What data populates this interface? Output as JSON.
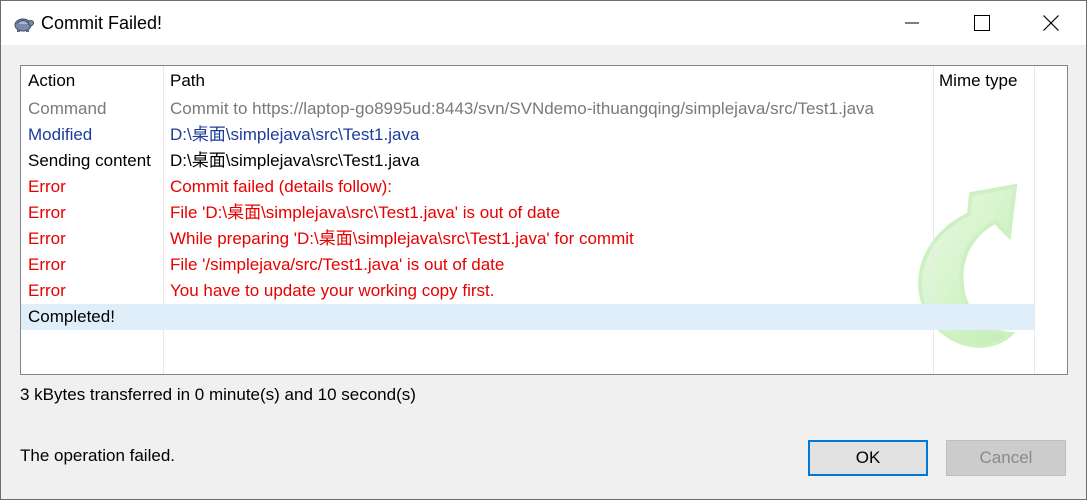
{
  "window": {
    "title": "Commit Failed!",
    "icon": "tortoisesvn-turtle-icon"
  },
  "columns": {
    "action": "Action",
    "path": "Path",
    "mime": "Mime type"
  },
  "rows": [
    {
      "action": "Command",
      "path": "Commit to https://laptop-go8995ud:8443/svn/SVNdemo-ithuangqing/simplejava/src/Test1.java",
      "color": "#7a7a7a"
    },
    {
      "action": "Modified",
      "path": "D:\\桌面\\simplejava\\src\\Test1.java",
      "color": "#1c3c9c"
    },
    {
      "action": "Sending content",
      "path": "D:\\桌面\\simplejava\\src\\Test1.java",
      "color": "#000000"
    },
    {
      "action": "Error",
      "path": "Commit failed (details follow):",
      "color": "#e60000"
    },
    {
      "action": "Error",
      "path": "File 'D:\\桌面\\simplejava\\src\\Test1.java' is out of date",
      "color": "#e60000"
    },
    {
      "action": "Error",
      "path": "While preparing 'D:\\桌面\\simplejava\\src\\Test1.java' for commit",
      "color": "#e60000"
    },
    {
      "action": "Error",
      "path": "File '/simplejava/src/Test1.java' is out of date",
      "color": "#e60000"
    },
    {
      "action": "Error",
      "path": "You have to update your working copy first.",
      "color": "#e60000"
    },
    {
      "action": "Completed!",
      "path": "",
      "color": "#000000"
    }
  ],
  "transfer_text": "3 kBytes transferred in 0 minute(s) and 10 second(s)",
  "status_text": "The operation failed.",
  "buttons": {
    "ok": "OK",
    "cancel": "Cancel"
  },
  "colors": {
    "accent": "#0078d7",
    "error": "#e60000",
    "modified": "#1c3c9c",
    "selected_row": "#e0eef9"
  }
}
